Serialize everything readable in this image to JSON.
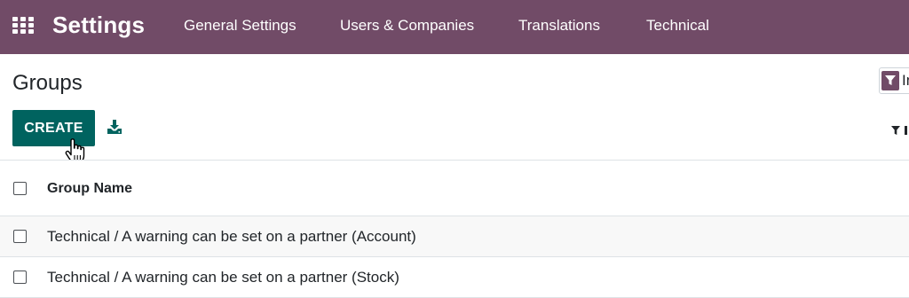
{
  "navbar": {
    "apps_icon": "apps-grid-icon",
    "brand": "Settings",
    "menu": [
      {
        "label": "General Settings"
      },
      {
        "label": "Users & Companies"
      },
      {
        "label": "Translations"
      },
      {
        "label": "Technical"
      }
    ],
    "color": "#714b67"
  },
  "control_panel": {
    "title": "Groups",
    "create_label": "CREATE",
    "create_color": "#00635f",
    "download_icon": "download-icon",
    "search": {
      "facet_icon": "filter-icon",
      "facet_text": "In"
    },
    "filter_icon": "filter-icon"
  },
  "list": {
    "columns": [
      {
        "label": "Group Name"
      }
    ],
    "rows": [
      {
        "name": "Technical / A warning can be set on a partner (Account)"
      },
      {
        "name": "Technical / A warning can be set on a partner (Stock)"
      }
    ]
  }
}
